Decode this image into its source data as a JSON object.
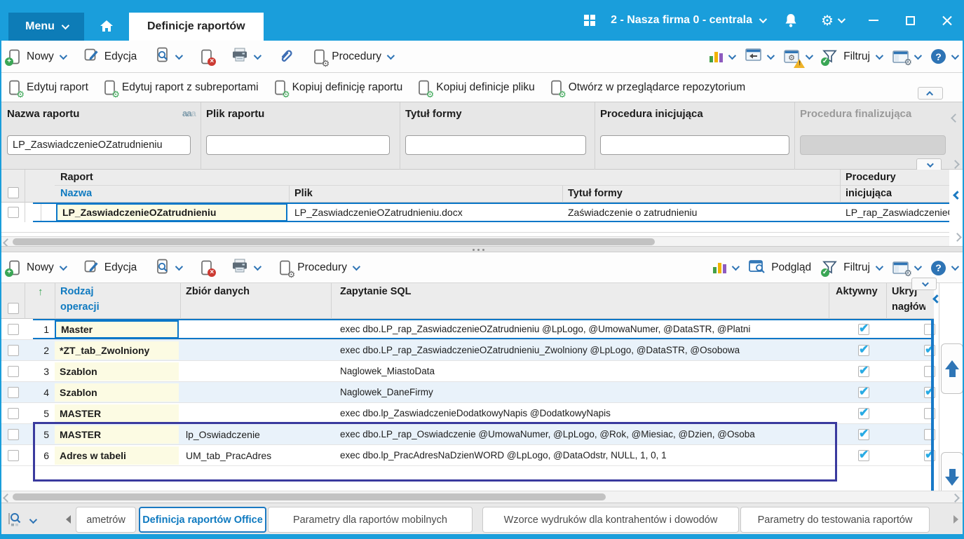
{
  "titlebar": {
    "menu_label": "Menu",
    "active_tab": "Definicje raportów",
    "company": "2 - Nasza firma 0 - centrala"
  },
  "toolbar_labels": {
    "nowy": "Nowy",
    "edycja": "Edycja",
    "procedury": "Procedury",
    "filtruj": "Filtruj",
    "podglad": "Podgląd"
  },
  "report_actions": [
    "Edytuj raport",
    "Edytuj raport z subreportami",
    "Kopiuj definicję raportu",
    "Kopiuj definicje pliku",
    "Otwórz w przeglądarce repozytorium"
  ],
  "filters": [
    {
      "label": "Nazwa raportu",
      "value": "LP_ZaswiadczenieOZatrudnieniu",
      "disabled": false,
      "case_badge": "aaa"
    },
    {
      "label": "Plik raportu",
      "value": "",
      "disabled": false
    },
    {
      "label": "Tytuł formy",
      "value": "",
      "disabled": false
    },
    {
      "label": "Procedura inicjująca",
      "value": "",
      "disabled": false
    },
    {
      "label": "Procedura finalizująca",
      "value": "",
      "disabled": true
    }
  ],
  "table1": {
    "group_header_left": "Raport",
    "group_header_right": "Procedury",
    "col_nazwa": "Nazwa",
    "col_plik": "Plik",
    "col_tytul": "Tytuł formy",
    "col_inicjujaca": "inicjująca",
    "row": {
      "nazwa": "LP_ZaswiadczenieOZatrudnieniu",
      "plik": "LP_ZaswiadczenieOZatrudnieniu.docx",
      "tytul": "Zaświadczenie o zatrudnieniu",
      "procedura": "LP_rap_ZaswiadczenieO"
    }
  },
  "table2": {
    "col_rodzaj_l1": "Rodzaj",
    "col_rodzaj_l2": "operacji",
    "col_zbior": "Zbiór danych",
    "col_sql": "Zapytanie SQL",
    "col_aktywny": "Aktywny",
    "col_ukryj_l1": "Ukryj",
    "col_ukryj_l2": "nagłówek",
    "rows": [
      {
        "num": "1",
        "rodzaj": "Master",
        "zbior": "",
        "sql": "exec dbo.LP_rap_ZaswiadczenieOZatrudnieniu @LpLogo, @UmowaNumer, @DataSTR, @Platni",
        "aktywny": true,
        "ukryj": false,
        "selected": true
      },
      {
        "num": "2",
        "rodzaj": "*ZT_tab_Zwolniony",
        "zbior": "",
        "sql": "exec dbo.LP_rap_ZaswiadczenieOZatrudnieniu_Zwolniony @LpLogo, @DataSTR, @Osobowa",
        "aktywny": true,
        "ukryj": true
      },
      {
        "num": "3",
        "rodzaj": "Szablon",
        "zbior": "",
        "sql": "Naglowek_MiastoData",
        "aktywny": true,
        "ukryj": false
      },
      {
        "num": "4",
        "rodzaj": "Szablon",
        "zbior": "",
        "sql": "Naglowek_DaneFirmy",
        "aktywny": true,
        "ukryj": true
      },
      {
        "num": "5",
        "rodzaj": "MASTER",
        "zbior": "",
        "sql": "exec dbo.lp_ZaswiadczenieDodatkowyNapis @DodatkowyNapis",
        "aktywny": true,
        "ukryj": false
      },
      {
        "num": "5",
        "rodzaj": "MASTER",
        "zbior": "lp_Oswiadczenie",
        "sql": "exec dbo.LP_rap_Oswiadczenie @UmowaNumer, @LpLogo, @Rok, @Miesiac, @Dzien, @Osoba",
        "aktywny": true,
        "ukryj": false,
        "annotated": true
      },
      {
        "num": "6",
        "rodzaj": "Adres w tabeli",
        "zbior": "UM_tab_PracAdres",
        "sql": "exec dbo.lp_PracAdresNaDzienWORD @LpLogo, @DataOdstr, NULL, 1, 0, 1",
        "aktywny": true,
        "ukryj": true,
        "annotated": true
      }
    ]
  },
  "bottom_tabs": [
    {
      "label": "ametrów",
      "active": false
    },
    {
      "label": "Definicja raportów Office",
      "active": true
    },
    {
      "label": "Parametry dla raportów mobilnych",
      "active": false
    },
    {
      "label": "Wzorce wydruków dla kontrahentów i dowodów",
      "active": false
    },
    {
      "label": "Parametry do testowania raportów",
      "active": false
    }
  ],
  "colors": {
    "topbar": "#1a9edb",
    "accent_blue": "#0f7ac0",
    "selection_border": "#0a77c8",
    "yellow_cell": "#fcfbe3",
    "alt_row": "#e9f2fa",
    "check_blue": "#29abe4",
    "annotation": "#3a3a9e",
    "green": "#3aa655",
    "red": "#cc3b33"
  }
}
